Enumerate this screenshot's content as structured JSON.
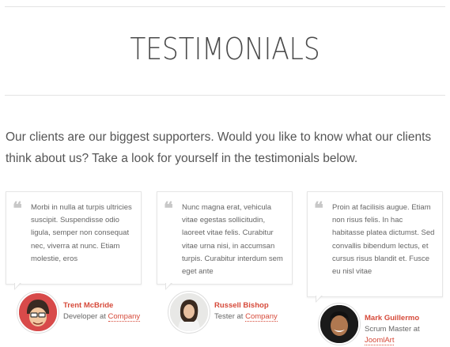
{
  "page": {
    "title": "TESTIMONIALS",
    "intro": "Our clients are our biggest supporters. Would you like to know what our clients think about us? Take a look for yourself in the testimonials below."
  },
  "testimonials": [
    {
      "quote": "Morbi in nulla at turpis ultricies suscipit. Suspendisse odio ligula, semper non consequat nec, viverra at nunc. Etiam molestie, eros",
      "name": "Trent McBride",
      "role": "Developer at",
      "company": "Company",
      "avatar_icon": "cartoon-face-avatar"
    },
    {
      "quote": "Nunc magna erat, vehicula vitae egestas sollicitudin, laoreet vitae felis. Curabitur vitae urna nisi, in accumsan turpis. Curabitur interdum sem eget ante",
      "name": "Russell Bishop",
      "role": "Tester at",
      "company": "Company",
      "avatar_icon": "woman-photo-avatar"
    },
    {
      "quote": "Proin at facilisis augue. Etiam non risus felis. In hac habitasse platea dictumst. Sed convallis bibendum lectus, et cursus risus blandit et. Fusce eu nisl vitae",
      "name": "Mark Guillermo",
      "role": "Scrum Master at",
      "company": "JoomlArt",
      "avatar_icon": "man-photo-avatar"
    }
  ],
  "colors": {
    "accent": "#d64a3a",
    "quote_mark": "#c8c8c8",
    "rule": "#e3e3e3"
  }
}
